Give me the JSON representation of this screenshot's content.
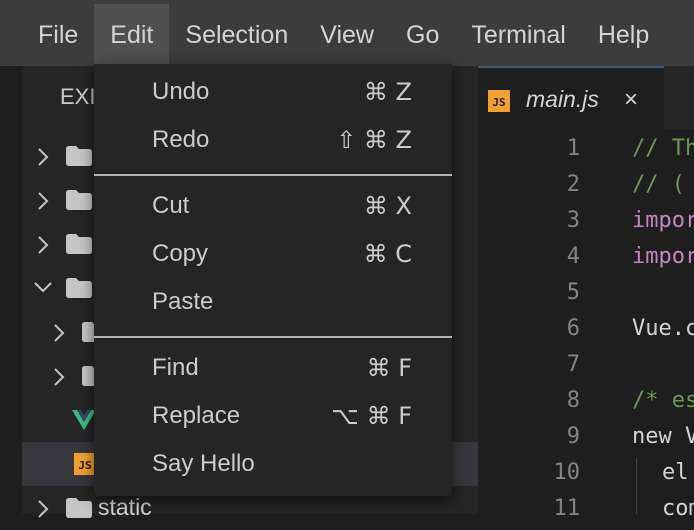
{
  "menubar": {
    "items": [
      {
        "label": "File"
      },
      {
        "label": "Edit",
        "active": true
      },
      {
        "label": "Selection"
      },
      {
        "label": "View"
      },
      {
        "label": "Go"
      },
      {
        "label": "Terminal"
      },
      {
        "label": "Help"
      }
    ]
  },
  "sidebar": {
    "title": "EXI",
    "tree": {
      "static_label": "static"
    }
  },
  "editor": {
    "tab": {
      "label": "main.js",
      "icon_text": "JS",
      "close": "×"
    },
    "line_numbers": [
      "1",
      "2",
      "3",
      "4",
      "5",
      "6",
      "7",
      "8",
      "9",
      "10",
      "11"
    ],
    "lines": [
      "// Th",
      "// (",
      "impor",
      "impor",
      "",
      "Vue.c",
      "",
      "/* es",
      "new V",
      "el",
      "com"
    ]
  },
  "edit_menu": {
    "items": [
      {
        "label": "Undo",
        "shortcut": "⌘ Z"
      },
      {
        "label": "Redo",
        "shortcut": "⇧ ⌘ Z"
      },
      {
        "label": "Cut",
        "shortcut": "⌘ X"
      },
      {
        "label": "Copy",
        "shortcut": "⌘ C"
      },
      {
        "label": "Paste",
        "shortcut": ""
      },
      {
        "label": "Find",
        "shortcut": "⌘ F"
      },
      {
        "label": "Replace",
        "shortcut": "⌥ ⌘ F"
      },
      {
        "label": "Say Hello",
        "shortcut": ""
      }
    ]
  },
  "colors": {
    "menubar_bg": "#3c3c3c",
    "menu_active_bg": "#505050",
    "sidebar_bg": "#252526",
    "editor_bg": "#1e1e1e",
    "js_icon": "#f0a030",
    "vue_icon": "#41b883"
  }
}
